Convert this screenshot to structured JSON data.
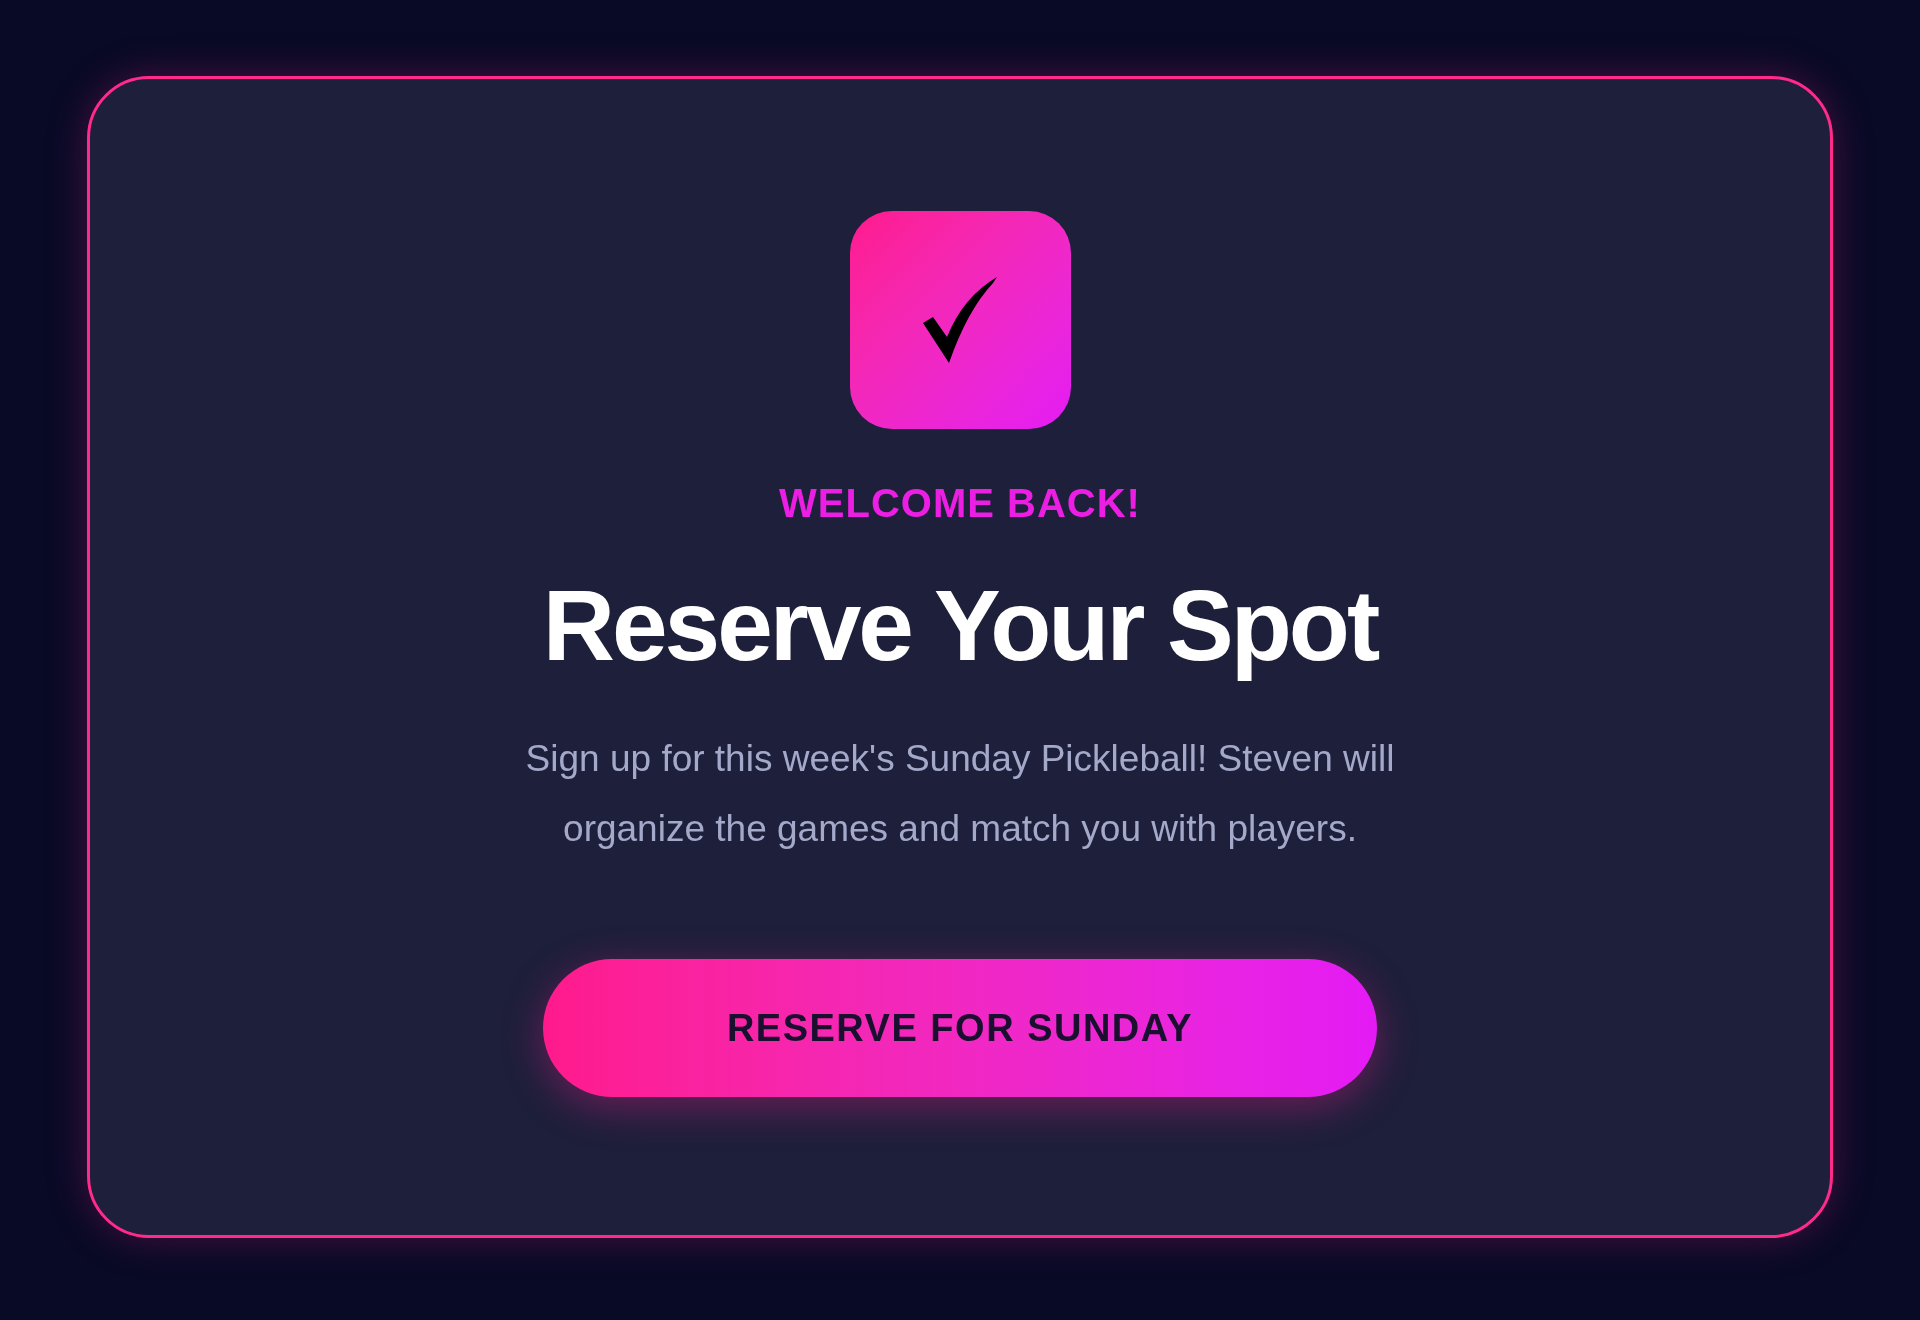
{
  "eyebrow": "WELCOME BACK!",
  "title": "Reserve Your Spot",
  "description": "Sign up for this week's Sunday Pickleball! Steven will organize the games and match you with players.",
  "button": {
    "label": "RESERVE FOR SUNDAY"
  }
}
